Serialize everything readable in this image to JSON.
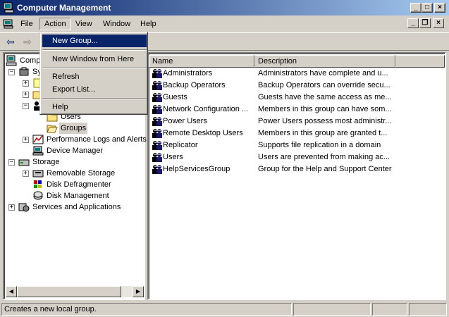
{
  "window": {
    "title": "Computer Management"
  },
  "menubar": {
    "items": [
      "File",
      "Action",
      "View",
      "Window",
      "Help"
    ]
  },
  "action_menu": {
    "items": [
      "New Group...",
      "New Window from Here",
      "Refresh",
      "Export List...",
      "Help"
    ],
    "highlighted": "New Group..."
  },
  "tree": {
    "root": "Computer Management (Local)",
    "root_visible": "Compu",
    "system_visible": "Sy",
    "users": "Users",
    "groups": "Groups",
    "perf": "Performance Logs and Alerts",
    "device_manager": "Device Manager",
    "storage": "Storage",
    "removable": "Removable Storage",
    "defrag": "Disk Defragmenter",
    "diskmgmt": "Disk Management",
    "services": "Services and Applications"
  },
  "list": {
    "columns": [
      "Name",
      "Description"
    ],
    "rows": [
      {
        "name": "Administrators",
        "description": "Administrators have complete and u..."
      },
      {
        "name": "Backup Operators",
        "description": "Backup Operators can override secu..."
      },
      {
        "name": "Guests",
        "description": "Guests have the same access as me..."
      },
      {
        "name": "Network Configuration ...",
        "description": "Members in this group can have som..."
      },
      {
        "name": "Power Users",
        "description": "Power Users possess most administr..."
      },
      {
        "name": "Remote Desktop Users",
        "description": "Members in this group are granted t..."
      },
      {
        "name": "Replicator",
        "description": "Supports file replication in a domain"
      },
      {
        "name": "Users",
        "description": "Users are prevented from making ac..."
      },
      {
        "name": "HelpServicesGroup",
        "description": "Group for the Help and Support Center"
      }
    ]
  },
  "statusbar": {
    "text": "Creates a new local group."
  },
  "colors": {
    "title_start": "#0a246a",
    "title_end": "#a6caf0",
    "highlight": "#0a246a",
    "face": "#d4d0c8"
  }
}
